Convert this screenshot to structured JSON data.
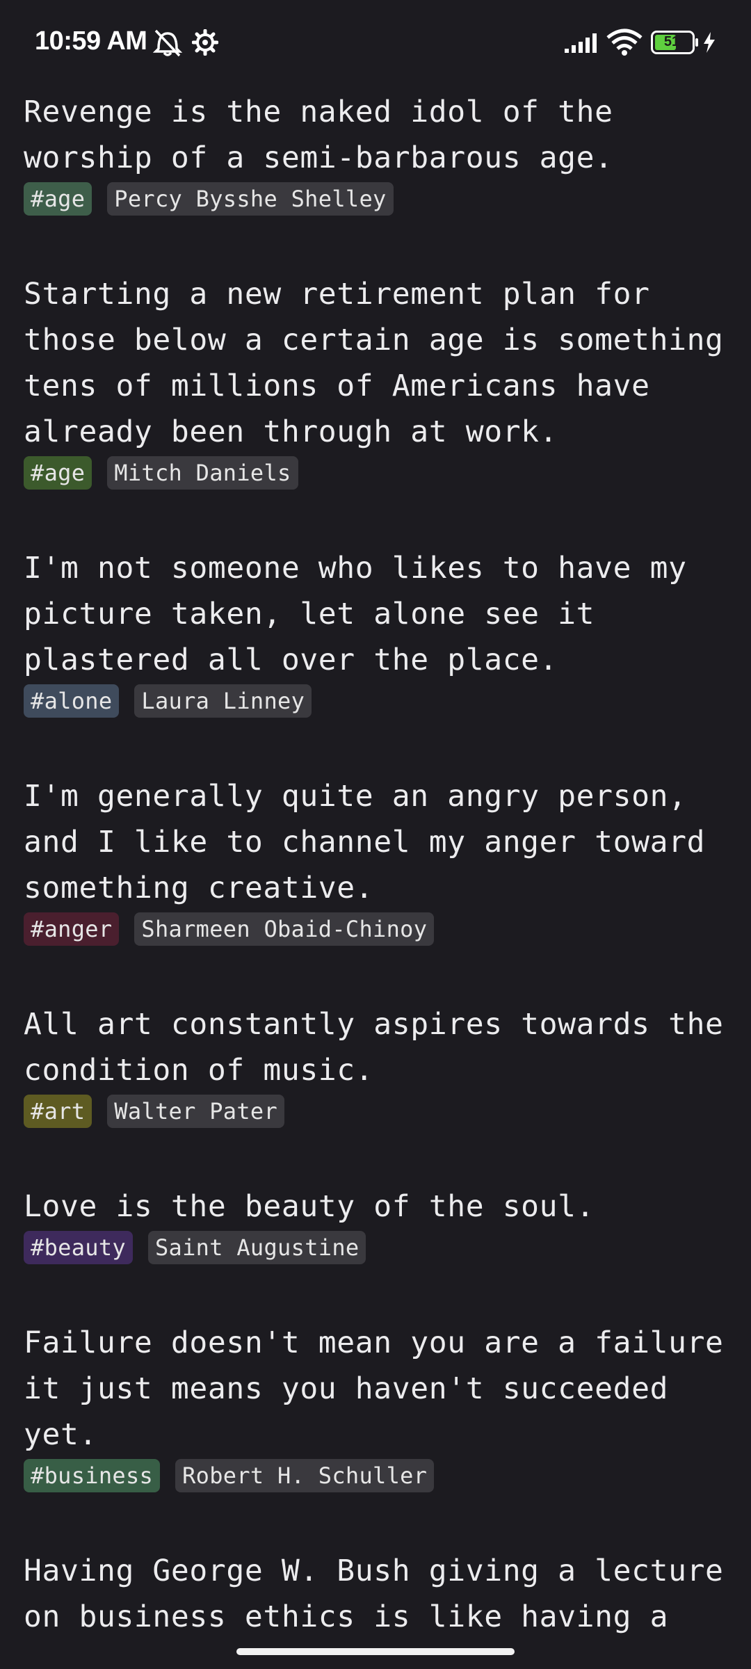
{
  "status_bar": {
    "time": "10:59 AM",
    "battery_level": "51",
    "icons": [
      "mute-bell-icon",
      "settings-gear-icon",
      "signal-icon",
      "wifi-icon",
      "battery-icon",
      "charging-bolt-icon"
    ]
  },
  "quotes": [
    {
      "text": "Revenge is the naked idol of the worship of a semi-barbarous age.",
      "tag": "#age",
      "tag_color": "#3e5e4a",
      "author": "Percy Bysshe Shelley"
    },
    {
      "text": "Starting a new retirement plan for those below a certain age is something tens of millions of Americans have already been through at work.",
      "tag": "#age",
      "tag_color": "#3c5a2c",
      "author": "Mitch Daniels"
    },
    {
      "text": "I'm not someone who likes to have my picture taken, let alone see it plastered all over the place.",
      "tag": "#alone",
      "tag_color": "#3f4b5c",
      "author": "Laura Linney"
    },
    {
      "text": "I'm generally quite an angry person, and I like to channel my anger toward something creative.",
      "tag": "#anger",
      "tag_color": "#4a1f2e",
      "author": "Sharmeen Obaid-Chinoy"
    },
    {
      "text": "All art constantly aspires towards the condition of music.",
      "tag": "#art",
      "tag_color": "#5e5b22",
      "author": "Walter Pater"
    },
    {
      "text": "Love is the beauty of the soul.",
      "tag": "#beauty",
      "tag_color": "#3e2a5c",
      "author": "Saint Augustine"
    },
    {
      "text": "Failure doesn't mean you are a failure it just means you haven't succeeded yet.",
      "tag": "#business",
      "tag_color": "#385e46",
      "author": "Robert H. Schuller"
    },
    {
      "text": "Having George W. Bush giving a lecture on business ethics is like having a leper give you a facial, it just doesn't work!",
      "tag": "",
      "tag_color": "",
      "author": ""
    }
  ]
}
